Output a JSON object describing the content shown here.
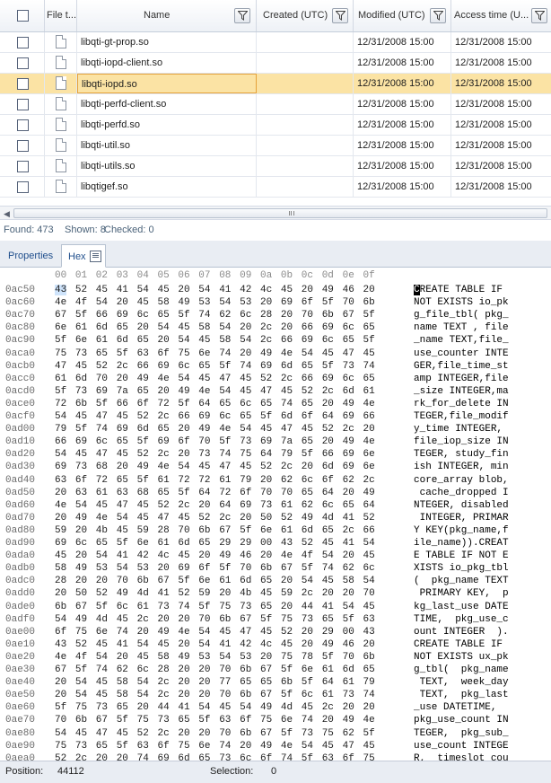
{
  "grid": {
    "columns": [
      {
        "label": "",
        "kind": "checkbox"
      },
      {
        "label": "File t...",
        "kind": "type"
      },
      {
        "label": "Name",
        "kind": "name"
      },
      {
        "label": "Created (UTC)",
        "kind": "created"
      },
      {
        "label": "Modified (UTC)",
        "kind": "modified"
      },
      {
        "label": "Access time (U...",
        "kind": "access"
      }
    ],
    "rows": [
      {
        "name": "libqti-gt-prop.so",
        "created": "",
        "modified": "12/31/2008 15:00",
        "access": "12/31/2008 15:00",
        "selected": false
      },
      {
        "name": "libqti-iopd-client.so",
        "created": "",
        "modified": "12/31/2008 15:00",
        "access": "12/31/2008 15:00",
        "selected": false
      },
      {
        "name": "libqti-iopd.so",
        "created": "",
        "modified": "12/31/2008 15:00",
        "access": "12/31/2008 15:00",
        "selected": true
      },
      {
        "name": "libqti-perfd-client.so",
        "created": "",
        "modified": "12/31/2008 15:00",
        "access": "12/31/2008 15:00",
        "selected": false
      },
      {
        "name": "libqti-perfd.so",
        "created": "",
        "modified": "12/31/2008 15:00",
        "access": "12/31/2008 15:00",
        "selected": false
      },
      {
        "name": "libqti-util.so",
        "created": "",
        "modified": "12/31/2008 15:00",
        "access": "12/31/2008 15:00",
        "selected": false
      },
      {
        "name": "libqti-utils.so",
        "created": "",
        "modified": "12/31/2008 15:00",
        "access": "12/31/2008 15:00",
        "selected": false
      },
      {
        "name": "libqtigef.so",
        "created": "",
        "modified": "12/31/2008 15:00",
        "access": "12/31/2008 15:00",
        "selected": false
      }
    ]
  },
  "status": {
    "found": "Found: 473",
    "shown": "Shown: 8",
    "checked": "Checked: 0"
  },
  "tabs": [
    {
      "label": "Properties",
      "active": false
    },
    {
      "label": "Hex",
      "active": true
    }
  ],
  "hex": {
    "column_headers": [
      "00",
      "01",
      "02",
      "03",
      "04",
      "05",
      "06",
      "07",
      "08",
      "09",
      "0a",
      "0b",
      "0c",
      "0d",
      "0e",
      "0f"
    ],
    "lines": [
      {
        "addr": "0ac50",
        "bytes": "43 52 45 41 54 45 20 54 41 42 4c 45 20 49 46 20",
        "ascii": "CREATE TABLE IF "
      },
      {
        "addr": "0ac60",
        "bytes": "4e 4f 54 20 45 58 49 53 54 53 20 69 6f 5f 70 6b",
        "ascii": "NOT EXISTS io_pk"
      },
      {
        "addr": "0ac70",
        "bytes": "67 5f 66 69 6c 65 5f 74 62 6c 28 20 70 6b 67 5f",
        "ascii": "g_file_tbl( pkg_"
      },
      {
        "addr": "0ac80",
        "bytes": "6e 61 6d 65 20 54 45 58 54 20 2c 20 66 69 6c 65",
        "ascii": "name TEXT , file"
      },
      {
        "addr": "0ac90",
        "bytes": "5f 6e 61 6d 65 20 54 45 58 54 2c 66 69 6c 65 5f",
        "ascii": "_name TEXT,file_"
      },
      {
        "addr": "0aca0",
        "bytes": "75 73 65 5f 63 6f 75 6e 74 20 49 4e 54 45 47 45",
        "ascii": "use_counter INTE"
      },
      {
        "addr": "0acb0",
        "bytes": "47 45 52 2c 66 69 6c 65 5f 74 69 6d 65 5f 73 74",
        "ascii": "GER,file_time_st"
      },
      {
        "addr": "0acc0",
        "bytes": "61 6d 70 20 49 4e 54 45 47 45 52 2c 66 69 6c 65",
        "ascii": "amp INTEGER,file"
      },
      {
        "addr": "0acd0",
        "bytes": "5f 73 69 7a 65 20 49 4e 54 45 47 45 52 2c 6d 61",
        "ascii": "_size INTEGER,ma"
      },
      {
        "addr": "0ace0",
        "bytes": "72 6b 5f 66 6f 72 5f 64 65 6c 65 74 65 20 49 4e",
        "ascii": "rk_for_delete IN"
      },
      {
        "addr": "0acf0",
        "bytes": "54 45 47 45 52 2c 66 69 6c 65 5f 6d 6f 64 69 66",
        "ascii": "TEGER,file_modif"
      },
      {
        "addr": "0ad00",
        "bytes": "79 5f 74 69 6d 65 20 49 4e 54 45 47 45 52 2c 20",
        "ascii": "y_time INTEGER, "
      },
      {
        "addr": "0ad10",
        "bytes": "66 69 6c 65 5f 69 6f 70 5f 73 69 7a 65 20 49 4e",
        "ascii": "file_iop_size IN"
      },
      {
        "addr": "0ad20",
        "bytes": "54 45 47 45 52 2c 20 73 74 75 64 79 5f 66 69 6e",
        "ascii": "TEGER, study_fin"
      },
      {
        "addr": "0ad30",
        "bytes": "69 73 68 20 49 4e 54 45 47 45 52 2c 20 6d 69 6e",
        "ascii": "ish INTEGER, min"
      },
      {
        "addr": "0ad40",
        "bytes": "63 6f 72 65 5f 61 72 72 61 79 20 62 6c 6f 62 2c",
        "ascii": "core_array blob,"
      },
      {
        "addr": "0ad50",
        "bytes": "20 63 61 63 68 65 5f 64 72 6f 70 70 65 64 20 49",
        "ascii": " cache_dropped I"
      },
      {
        "addr": "0ad60",
        "bytes": "4e 54 45 47 45 52 2c 20 64 69 73 61 62 6c 65 64",
        "ascii": "NTEGER, disabled"
      },
      {
        "addr": "0ad70",
        "bytes": "20 49 4e 54 45 47 45 52 2c 20 50 52 49 4d 41 52",
        "ascii": " INTEGER, PRIMAR"
      },
      {
        "addr": "0ad80",
        "bytes": "59 20 4b 45 59 28 70 6b 67 5f 6e 61 6d 65 2c 66",
        "ascii": "Y KEY(pkg_name,f"
      },
      {
        "addr": "0ad90",
        "bytes": "69 6c 65 5f 6e 61 6d 65 29 29 00 43 52 45 41 54",
        "ascii": "ile_name)).CREAT"
      },
      {
        "addr": "0ada0",
        "bytes": "45 20 54 41 42 4c 45 20 49 46 20 4e 4f 54 20 45",
        "ascii": "E TABLE IF NOT E"
      },
      {
        "addr": "0adb0",
        "bytes": "58 49 53 54 53 20 69 6f 5f 70 6b 67 5f 74 62 6c",
        "ascii": "XISTS io_pkg_tbl"
      },
      {
        "addr": "0adc0",
        "bytes": "28 20 20 70 6b 67 5f 6e 61 6d 65 20 54 45 58 54",
        "ascii": "(  pkg_name TEXT"
      },
      {
        "addr": "0add0",
        "bytes": "20 50 52 49 4d 41 52 59 20 4b 45 59 2c 20 20 70",
        "ascii": " PRIMARY KEY,  p"
      },
      {
        "addr": "0ade0",
        "bytes": "6b 67 5f 6c 61 73 74 5f 75 73 65 20 44 41 54 45",
        "ascii": "kg_last_use DATE"
      },
      {
        "addr": "0adf0",
        "bytes": "54 49 4d 45 2c 20 20 70 6b 67 5f 75 73 65 5f 63",
        "ascii": "TIME,  pkg_use_c"
      },
      {
        "addr": "0ae00",
        "bytes": "6f 75 6e 74 20 49 4e 54 45 47 45 52 20 29 00 43",
        "ascii": "ount INTEGER  )."
      },
      {
        "addr": "0ae10",
        "bytes": "43 52 45 41 54 45 20 54 41 42 4c 45 20 49 46 20",
        "ascii": "CREATE TABLE IF "
      },
      {
        "addr": "0ae20",
        "bytes": "4e 4f 54 20 45 58 49 53 54 53 20 75 78 5f 70 6b",
        "ascii": "NOT EXISTS ux_pk"
      },
      {
        "addr": "0ae30",
        "bytes": "67 5f 74 62 6c 28 20 20 70 6b 67 5f 6e 61 6d 65",
        "ascii": "g_tbl(  pkg_name"
      },
      {
        "addr": "0ae40",
        "bytes": "20 54 45 58 54 2c 20 20 77 65 65 6b 5f 64 61 79",
        "ascii": " TEXT,  week_day"
      },
      {
        "addr": "0ae50",
        "bytes": "20 54 45 58 54 2c 20 20 70 6b 67 5f 6c 61 73 74",
        "ascii": " TEXT,  pkg_last"
      },
      {
        "addr": "0ae60",
        "bytes": "5f 75 73 65 20 44 41 54 45 54 49 4d 45 2c 20 20",
        "ascii": "_use DATETIME,  "
      },
      {
        "addr": "0ae70",
        "bytes": "70 6b 67 5f 75 73 65 5f 63 6f 75 6e 74 20 49 4e",
        "ascii": "pkg_use_count IN"
      },
      {
        "addr": "0ae80",
        "bytes": "54 45 47 45 52 2c 20 20 70 6b 67 5f 73 75 62 5f",
        "ascii": "TEGER,  pkg_sub_"
      },
      {
        "addr": "0ae90",
        "bytes": "75 73 65 5f 63 6f 75 6e 74 20 49 4e 54 45 47 45",
        "ascii": "use_count INTEGE"
      },
      {
        "addr": "0aea0",
        "bytes": "52 2c 20 20 74 69 6d 65 73 6c 6f 74 5f 63 6f 75",
        "ascii": "R,  timeslot_cou"
      }
    ]
  },
  "bottom": {
    "position_label": "Position:",
    "position_value": "44112",
    "selection_label": "Selection:",
    "selection_value": "0"
  },
  "colors": {
    "accent": "#1f4e8c",
    "selected_row": "#fbe3a4",
    "selected_border": "#e5a23a",
    "hex_highlight": "#cfe4fb"
  },
  "icons": {
    "filter": "filter-icon",
    "file": "file-icon",
    "hex_tab": "hex-view-icon",
    "scroll_left": "arrow-left-icon"
  }
}
